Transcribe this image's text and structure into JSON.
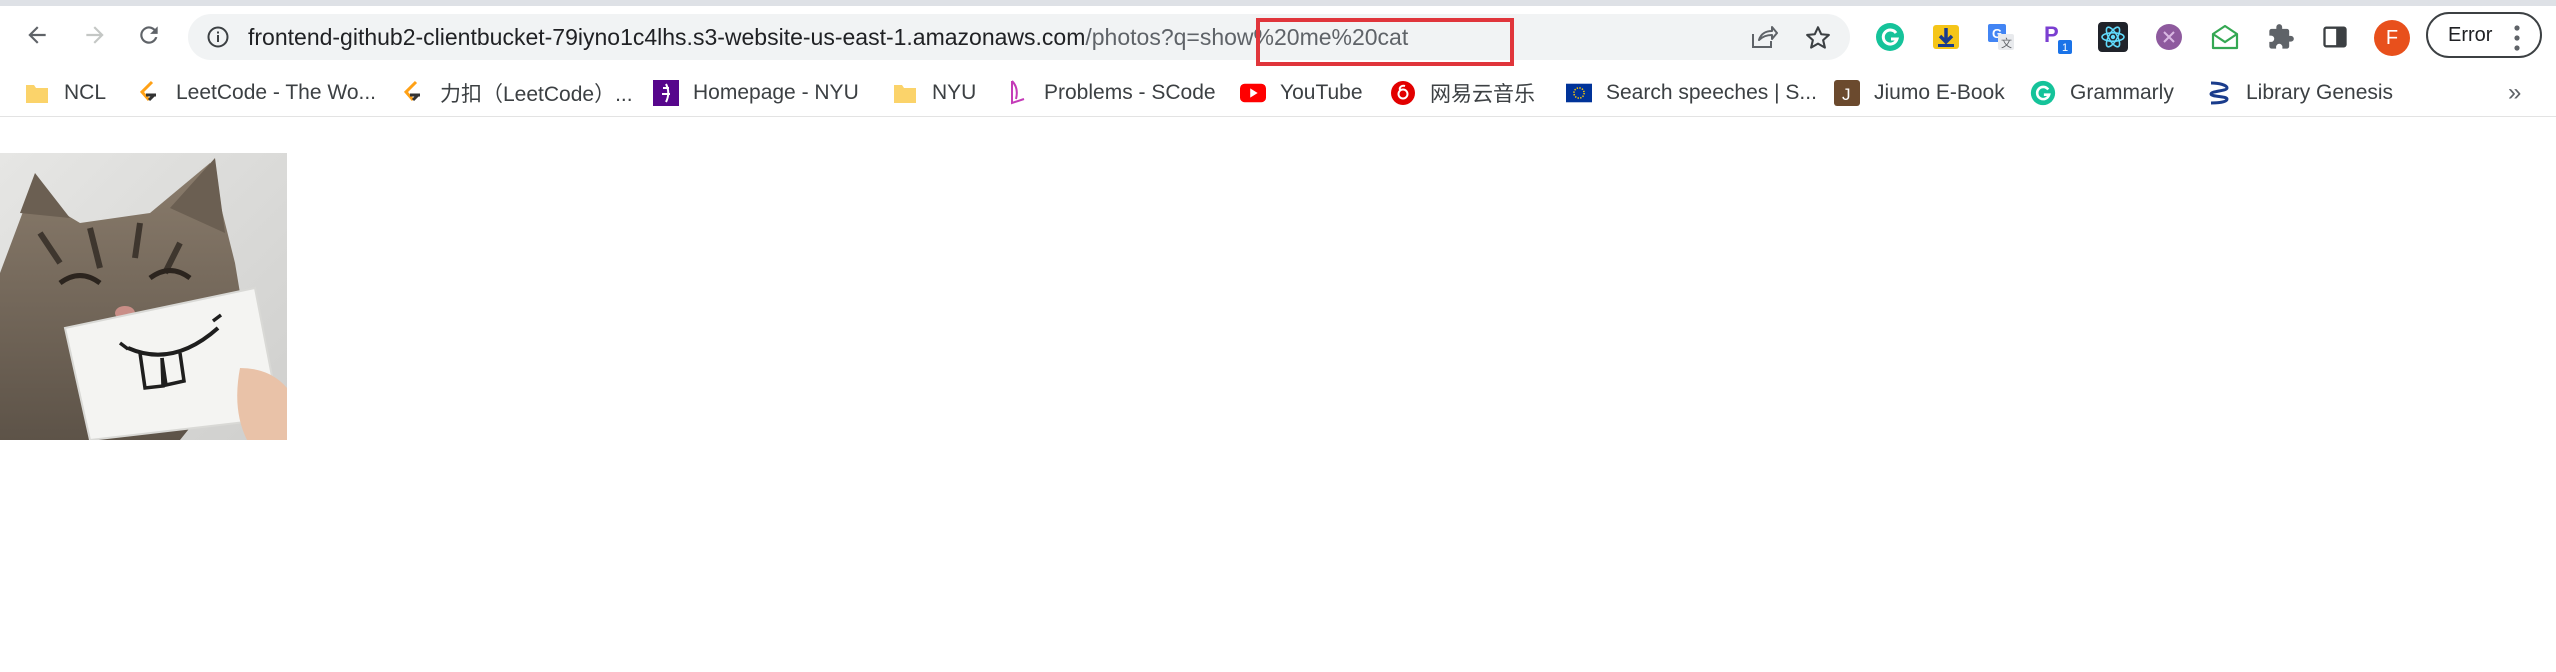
{
  "browser": {
    "url": {
      "host": "frontend-github2-clientbucket-79iyno1c4lhs.s3-website-us-east-1.amazonaws.com",
      "path": "/photos?q=",
      "query": "show%20me%20cat"
    },
    "profile_initial": "F",
    "error_label": "Error"
  },
  "bookmarks": [
    {
      "label": "NCL",
      "icon": "folder-icon"
    },
    {
      "label": "LeetCode - The Wo...",
      "icon": "leetcode-icon"
    },
    {
      "label": "力扣（LeetCode）...",
      "icon": "leetcode-cn-icon"
    },
    {
      "label": "Homepage - NYU",
      "icon": "nyu-icon"
    },
    {
      "label": "NYU",
      "icon": "folder-icon"
    },
    {
      "label": "Problems - SCode",
      "icon": "scode-icon"
    },
    {
      "label": "YouTube",
      "icon": "youtube-icon"
    },
    {
      "label": "网易云音乐",
      "icon": "netease-music-icon"
    },
    {
      "label": "Search speeches | S...",
      "icon": "eu-flag-icon"
    },
    {
      "label": "Jiumo E-Book",
      "icon": "jiumo-icon"
    },
    {
      "label": "Grammarly",
      "icon": "grammarly-icon"
    },
    {
      "label": "Library Genesis",
      "icon": "libgen-icon"
    }
  ],
  "colors": {
    "highlight": "#e0353b",
    "profile": "#e8501c",
    "grammarly": "#15c39a"
  },
  "photo": {
    "description_icon": "cat-photo"
  }
}
